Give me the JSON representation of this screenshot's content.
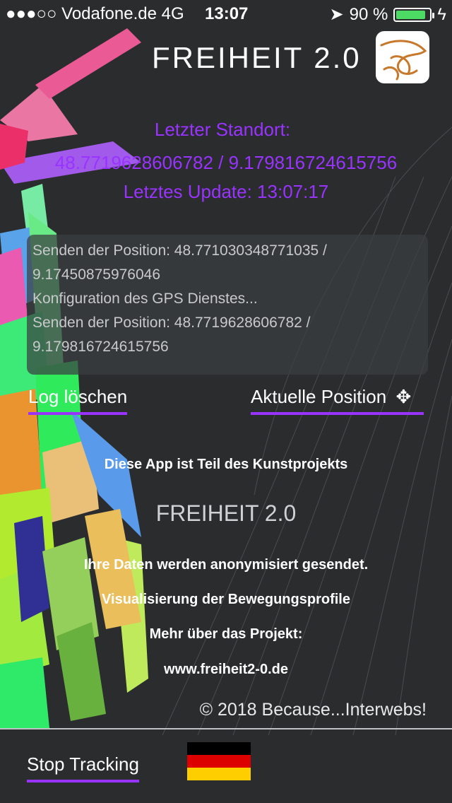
{
  "status_bar": {
    "carrier": "●●●○○ Vodafone.de  4G",
    "time": "13:07",
    "battery_pct": "90 %",
    "battery_level": 0.9,
    "location_icon": "location-arrow-icon",
    "charging_icon": "bolt-icon"
  },
  "header": {
    "title": "FREIHEIT 2.0"
  },
  "location": {
    "title": "Letzter Standort:",
    "coords": "48.7719628606782 / 9.179816724615756",
    "update": "Letztes Update: 13:07:17",
    "color": "#9933ff"
  },
  "log": {
    "lines": [
      "Senden der Position: 48.771030348771035 /",
      "9.17450875976046",
      "Konfiguration des GPS Dienstes...",
      "Senden der Position: 48.7719628606782 /",
      "9.179816724615756"
    ]
  },
  "actions": {
    "clear_log": "Log löschen",
    "current_position": "Aktuelle Position"
  },
  "info": {
    "line1": "Diese App ist Teil des Kunstprojekts",
    "project": "FREIHEIT 2.0",
    "line2": "Ihre Daten werden anonymisiert gesendet.",
    "line3": "Visualisierung der Bewegungsprofile",
    "line4": "Mehr über das Projekt:",
    "url": "www.freiheit2-0.de",
    "copyright": "© 2018 Because...Interwebs!"
  },
  "footer": {
    "stop_tracking": "Stop Tracking"
  },
  "flag_colors": [
    "#000000",
    "#dd0000",
    "#ffce00"
  ]
}
